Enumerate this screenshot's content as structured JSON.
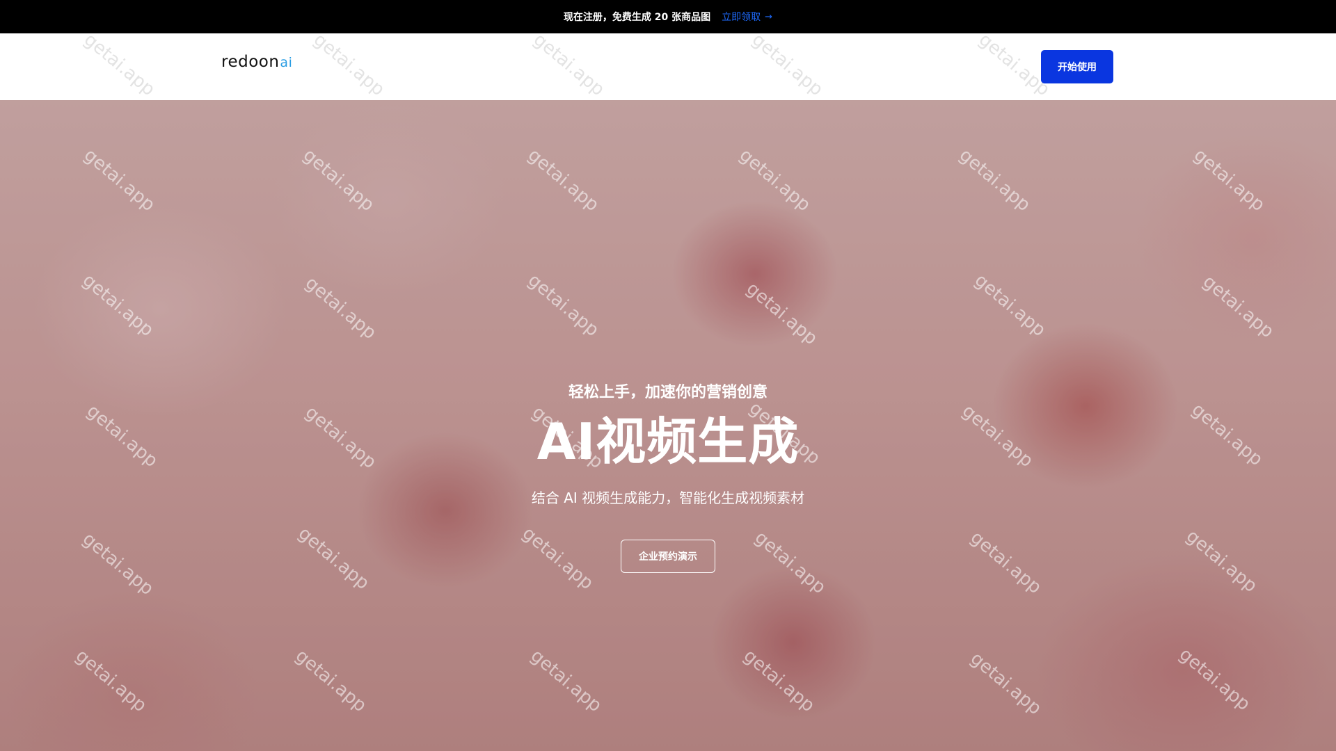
{
  "promo": {
    "text": "现在注册，免费生成 20 张商品图",
    "link_label": "立即领取",
    "arrow_icon": "arrow-right-icon"
  },
  "header": {
    "logo_main": "redoon",
    "logo_suffix": "ai",
    "start_label": "开始使用"
  },
  "hero": {
    "eyebrow": "轻松上手，加速你的营销创意",
    "title": "AI视频生成",
    "subtitle": "结合 AI 视频生成能力，智能化生成视频素材",
    "demo_label": "企业预约演示"
  },
  "watermark": {
    "text": "getai.app"
  },
  "colors": {
    "promo_bg": "#000000",
    "promo_link": "#1e6bff",
    "primary_button": "#0a36e0",
    "logo_accent": "#2a9de3"
  }
}
